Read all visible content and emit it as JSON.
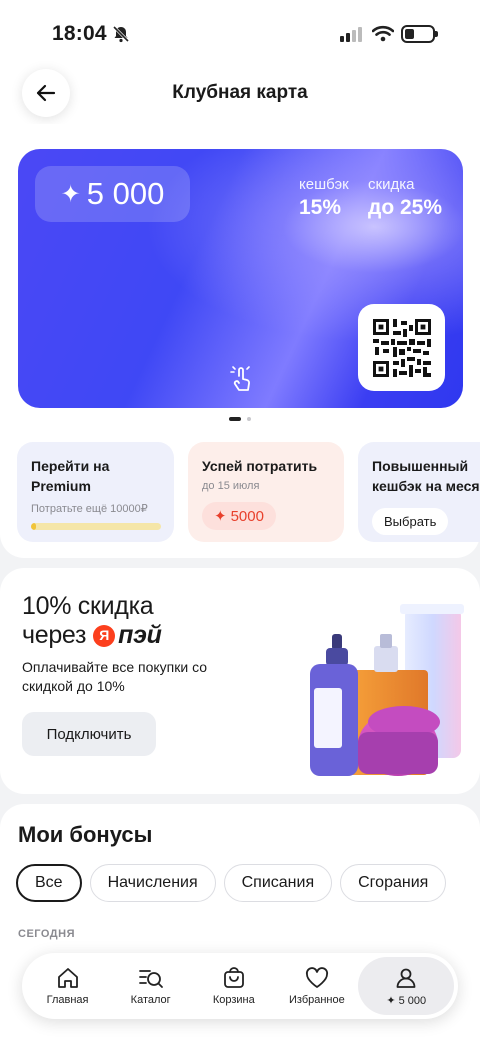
{
  "status": {
    "time": "18:04"
  },
  "header": {
    "title": "Клубная карта"
  },
  "card": {
    "balance": "5 000",
    "cashback_label": "кешбэк",
    "cashback_value": "15%",
    "discount_label": "скидка",
    "discount_value": "до 25%"
  },
  "offers": [
    {
      "title": "Перейти на Premium",
      "sub": "Потратьте ещё 10000₽",
      "progress": 0.04
    },
    {
      "title": "Успей потратить",
      "sub": "до 15 июля",
      "amount": "5000"
    },
    {
      "title": "Повышенный кешбэк на месяц",
      "button": "Выбрать"
    }
  ],
  "promo": {
    "title_line1": "10% скидка",
    "title_line2": "через",
    "logo_letter": "Я",
    "logo_word": "пэй",
    "subtitle": "Оплачивайте все покупки со скидкой до 10%",
    "button": "Подключить"
  },
  "bonuses": {
    "title": "Мои бонусы",
    "filters": [
      "Все",
      "Начисления",
      "Списания",
      "Сгорания"
    ],
    "section": "СЕГОДНЯ"
  },
  "tabbar": [
    {
      "label": "Главная",
      "icon": "home-icon"
    },
    {
      "label": "Каталог",
      "icon": "catalog-search-icon"
    },
    {
      "label": "Корзина",
      "icon": "cart-icon"
    },
    {
      "label": "Избранное",
      "icon": "heart-icon"
    },
    {
      "label": "✦ 5 000",
      "icon": "profile-icon"
    }
  ],
  "colors": {
    "card_blue": "#4b48f5",
    "accent_red": "#e8402c",
    "progress_yellow": "#f0c43a"
  }
}
